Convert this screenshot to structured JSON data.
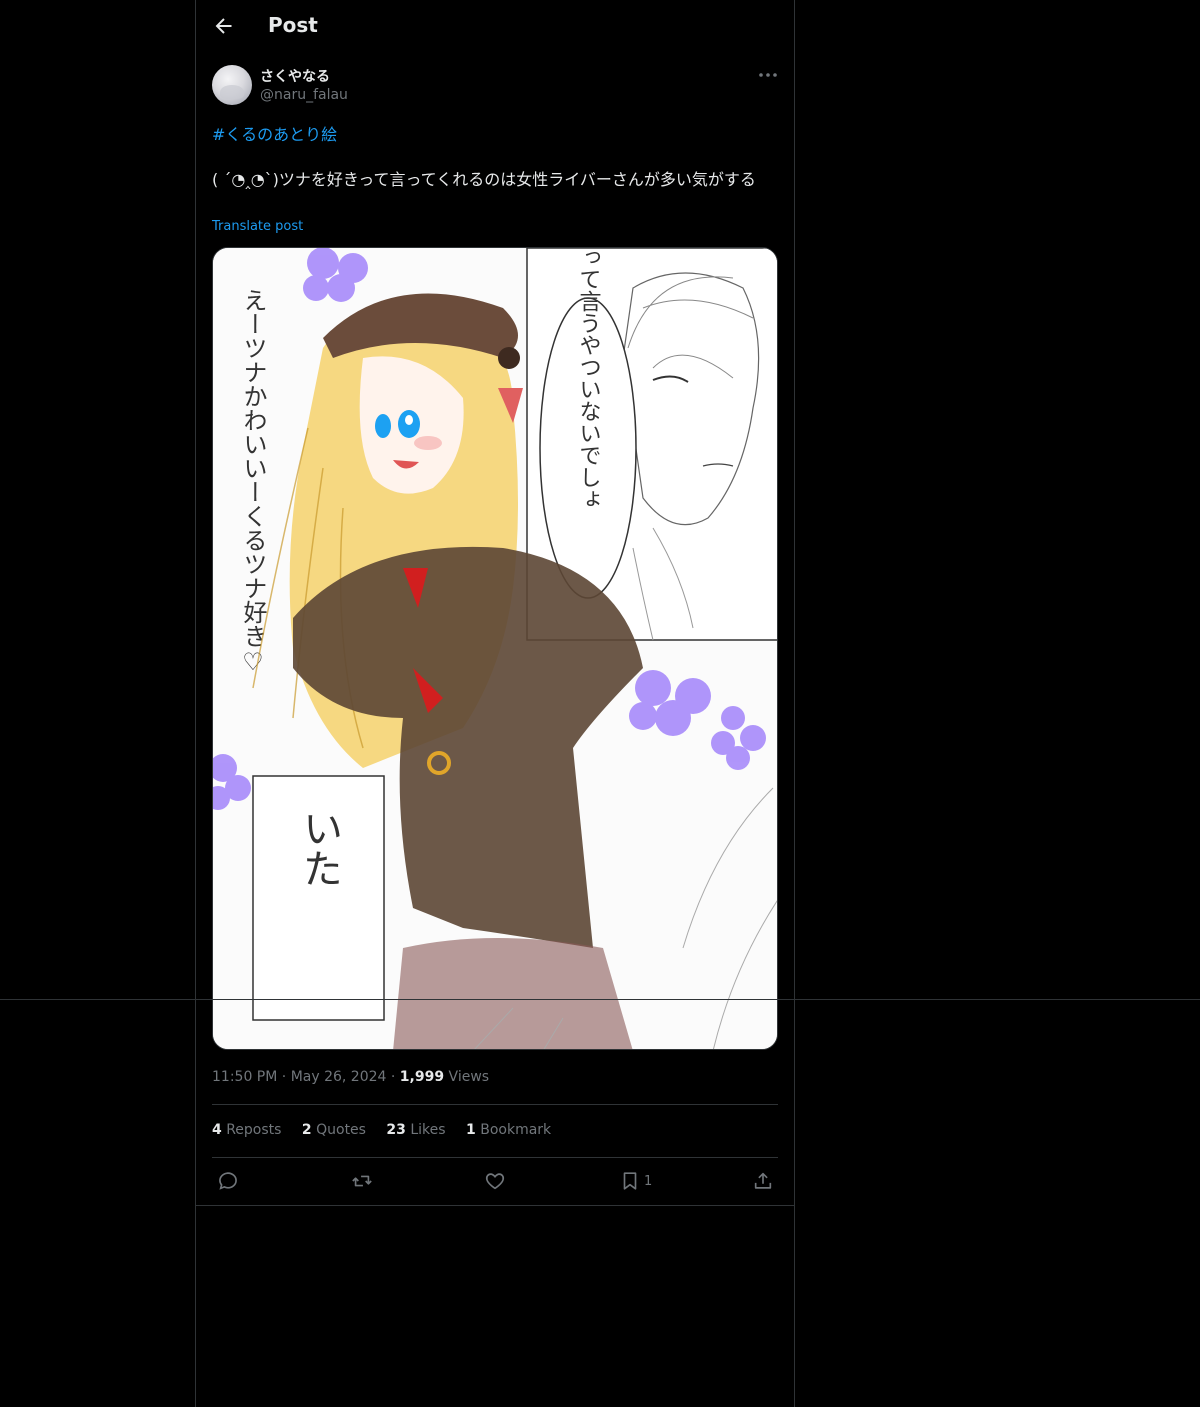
{
  "header": {
    "title": "Post",
    "back_icon": "back-arrow-icon"
  },
  "author": {
    "display_name": "さくやなる",
    "handle": "@naru_falau",
    "more_icon": "more-options-icon"
  },
  "post": {
    "hashtag": "#くるのあとり絵",
    "text": "( ´◔‸◔`)ツナを好きって言ってくれるのは女性ライバーさんが多い気がする",
    "translate_label": "Translate post",
    "image": {
      "speech_bubble": "ツナ可愛いって言うやついないでしょ",
      "side_text": "えーツナかわいいーくるツナ好き♡",
      "panel_text": "いた"
    }
  },
  "meta": {
    "time": "11:50 PM",
    "separator": "·",
    "date": "May 26, 2024",
    "views_count": "1,999",
    "views_label": "Views"
  },
  "stats": {
    "reposts_count": "4",
    "reposts_label": "Reposts",
    "quotes_count": "2",
    "quotes_label": "Quotes",
    "likes_count": "23",
    "likes_label": "Likes",
    "bookmarks_count": "1",
    "bookmarks_label": "Bookmark"
  },
  "actions": {
    "reply_icon": "reply-icon",
    "repost_icon": "repost-icon",
    "like_icon": "heart-icon",
    "bookmark_icon": "bookmark-icon",
    "bookmark_count": "1",
    "share_icon": "share-icon"
  },
  "colors": {
    "accent": "#1d9bf0",
    "muted": "#71767b",
    "text": "#e7e9ea",
    "border": "#2f3336",
    "background": "#000000"
  }
}
